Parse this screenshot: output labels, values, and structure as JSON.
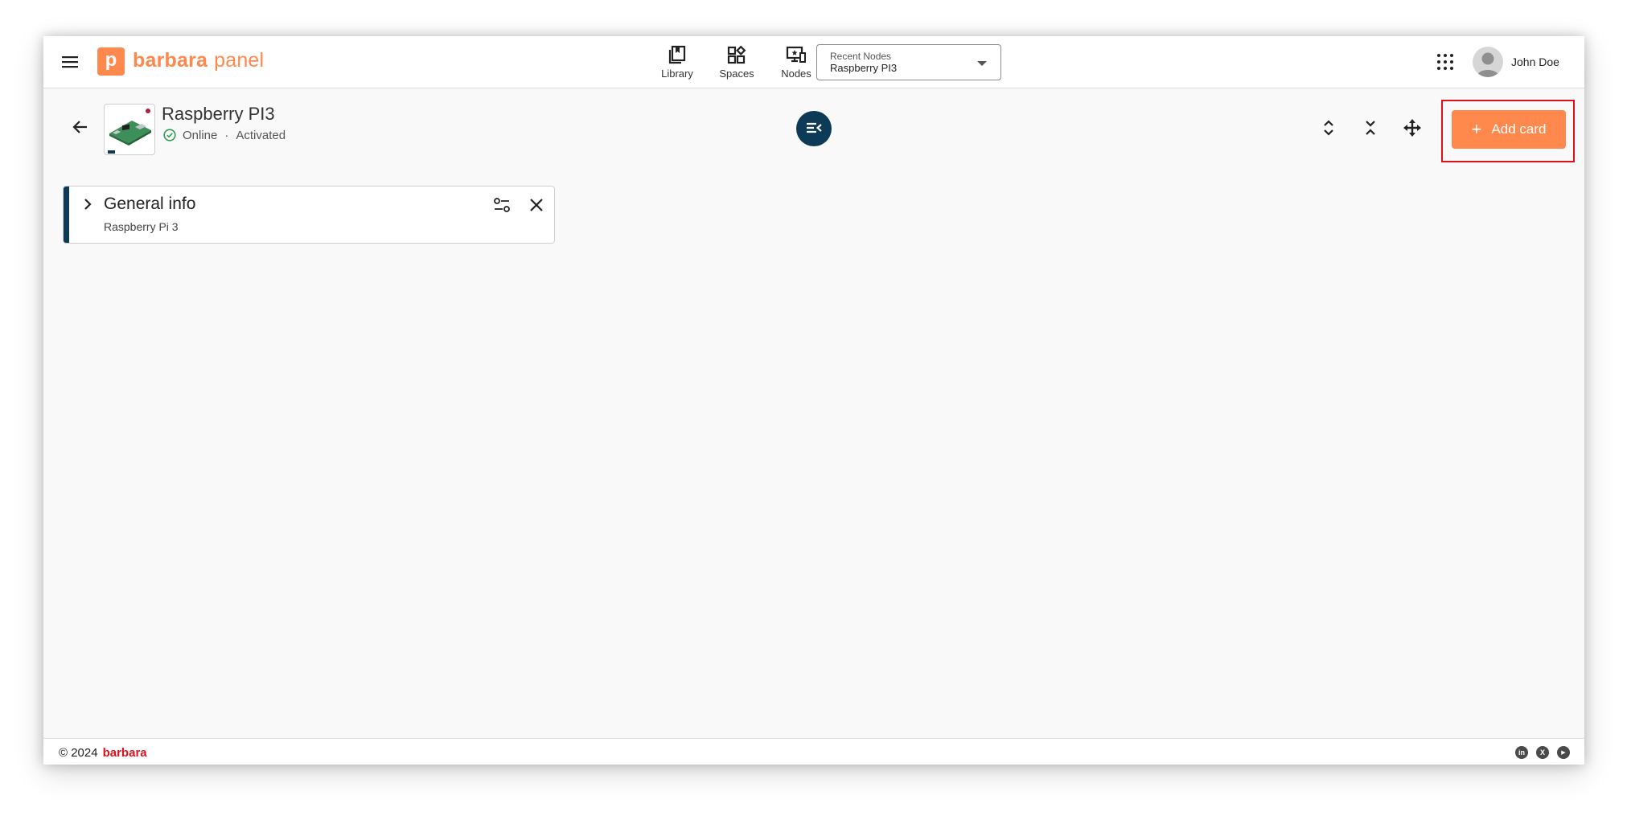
{
  "topbar": {
    "logo_letter": "p",
    "logo_brand": "barbara",
    "logo_product": "panel",
    "nav": [
      {
        "label": "Library",
        "icon": "library-icon"
      },
      {
        "label": "Spaces",
        "icon": "spaces-icon"
      },
      {
        "label": "Nodes",
        "icon": "nodes-icon"
      }
    ],
    "recent_nodes": {
      "label": "Recent Nodes",
      "value": "Raspberry PI3"
    },
    "user_name": "John Doe"
  },
  "node": {
    "title": "Raspberry PI3",
    "status": "Online",
    "separator": "·",
    "state": "Activated"
  },
  "actions": {
    "add_card_plus": "+",
    "add_card_label": "Add card"
  },
  "cards": [
    {
      "title": "General info",
      "subtitle": "Raspberry Pi 3"
    }
  ],
  "footer": {
    "copyright": "© 2024",
    "brand": "barbara",
    "social": [
      {
        "icon": "linkedin-icon",
        "glyph": "in"
      },
      {
        "icon": "x-icon",
        "glyph": "X"
      },
      {
        "icon": "youtube-icon",
        "glyph": "▶"
      }
    ]
  },
  "colors": {
    "brand_orange": "#ff884d",
    "navy": "#0d3b57",
    "highlight_red": "#e3101b",
    "status_green": "#2e9e4f"
  }
}
